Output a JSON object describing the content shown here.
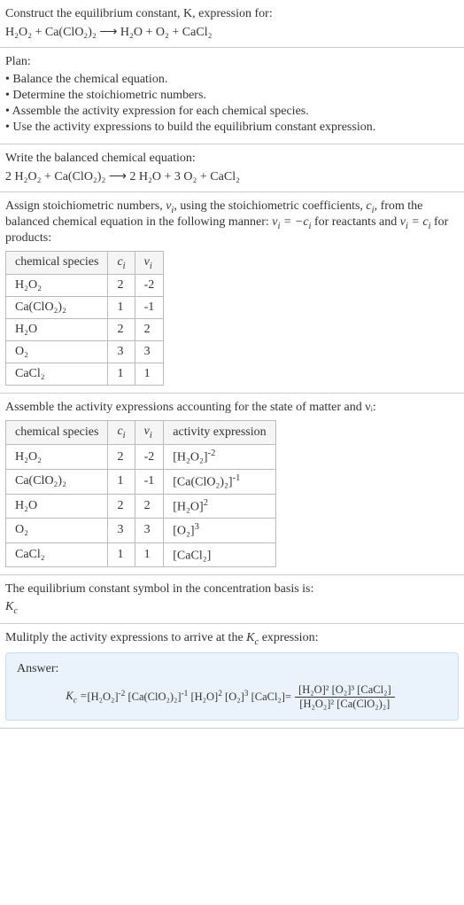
{
  "s1": {
    "prompt": "Construct the equilibrium constant, K, expression for:",
    "equation": "H₂O₂ + Ca(ClO₂)₂ ⟶ H₂O + O₂ + CaCl₂"
  },
  "s2": {
    "title": "Plan:",
    "items": [
      "• Balance the chemical equation.",
      "• Determine the stoichiometric numbers.",
      "• Assemble the activity expression for each chemical species.",
      "• Use the activity expressions to build the equilibrium constant expression."
    ]
  },
  "s3": {
    "prompt": "Write the balanced chemical equation:",
    "equation": "2 H₂O₂ + Ca(ClO₂)₂ ⟶ 2 H₂O + 3 O₂ + CaCl₂"
  },
  "s4": {
    "prompt_a": "Assign stoichiometric numbers, ",
    "prompt_b": ", using the stoichiometric coefficients, ",
    "prompt_c": ", from the balanced chemical equation in the following manner: ",
    "prompt_d": " for reactants and ",
    "prompt_e": " for products:",
    "headers": [
      "chemical species",
      "cᵢ",
      "νᵢ"
    ],
    "rows": [
      [
        "H₂O₂",
        "2",
        "-2"
      ],
      [
        "Ca(ClO₂)₂",
        "1",
        "-1"
      ],
      [
        "H₂O",
        "2",
        "2"
      ],
      [
        "O₂",
        "3",
        "3"
      ],
      [
        "CaCl₂",
        "1",
        "1"
      ]
    ]
  },
  "s5": {
    "prompt": "Assemble the activity expressions accounting for the state of matter and νᵢ:",
    "headers": [
      "chemical species",
      "cᵢ",
      "νᵢ",
      "activity expression"
    ],
    "rows": [
      {
        "sp": "H₂O₂",
        "c": "2",
        "v": "-2",
        "base": "[H₂O₂]",
        "exp": "-2"
      },
      {
        "sp": "Ca(ClO₂)₂",
        "c": "1",
        "v": "-1",
        "base": "[Ca(ClO₂)₂]",
        "exp": "-1"
      },
      {
        "sp": "H₂O",
        "c": "2",
        "v": "2",
        "base": "[H₂O]",
        "exp": "2"
      },
      {
        "sp": "O₂",
        "c": "3",
        "v": "3",
        "base": "[O₂]",
        "exp": "3"
      },
      {
        "sp": "CaCl₂",
        "c": "1",
        "v": "1",
        "base": "[CaCl₂]",
        "exp": ""
      }
    ]
  },
  "s6": {
    "prompt": "The equilibrium constant symbol in the concentration basis is:",
    "symbol": "K_c"
  },
  "s7": {
    "prompt": "Mulitply the activity expressions to arrive at the K_c expression:"
  },
  "answer": {
    "label": "Answer:",
    "lhs": "K_c = ",
    "terms": [
      {
        "base": "[H₂O₂]",
        "exp": "-2"
      },
      {
        "base": "[Ca(ClO₂)₂]",
        "exp": "-1"
      },
      {
        "base": "[H₂O]",
        "exp": "2"
      },
      {
        "base": "[O₂]",
        "exp": "3"
      },
      {
        "base": "[CaCl₂]",
        "exp": ""
      }
    ],
    "eq": " = ",
    "num": "[H₂O]² [O₂]³ [CaCl₂]",
    "den": "[H₂O₂]² [Ca(ClO₂)₂]"
  }
}
